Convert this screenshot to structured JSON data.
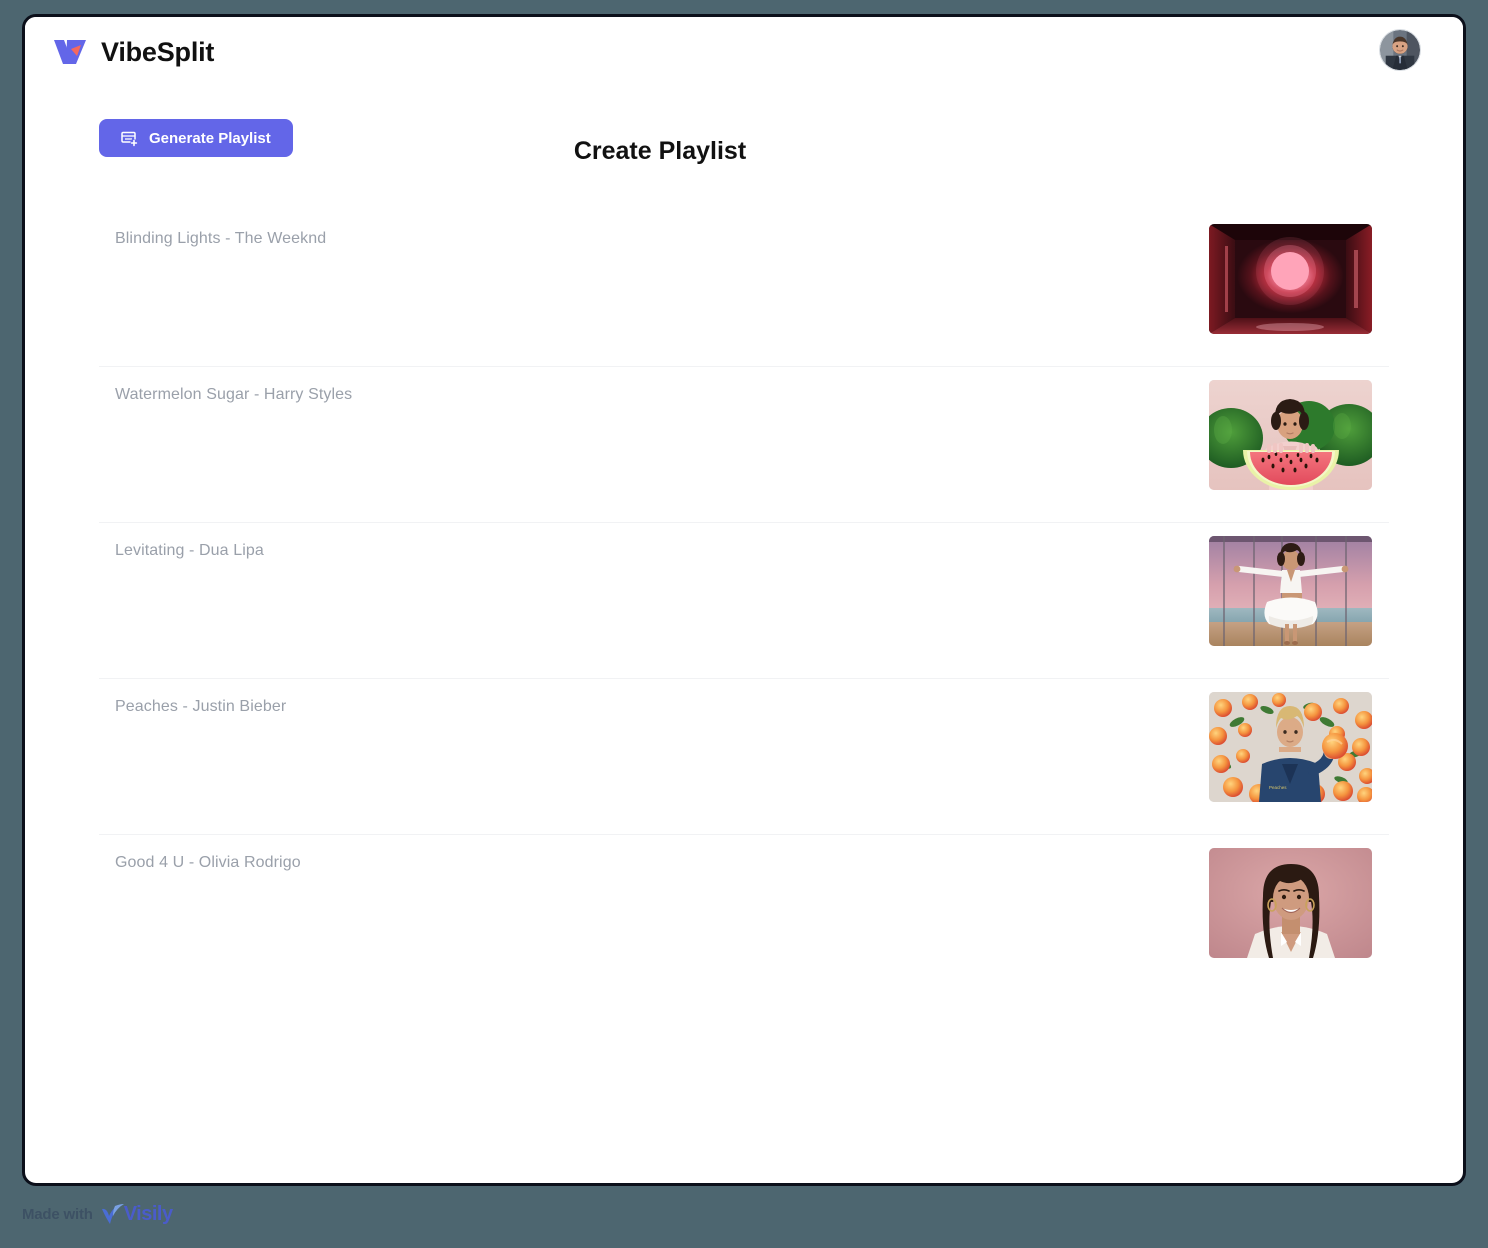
{
  "window": {
    "background_color": "#4d6670",
    "card_color": "#ffffff",
    "border_color": "#0b0f1a"
  },
  "header": {
    "brand_name": "VibeSplit",
    "brand_logo_icon": "vibesplit-logo-icon",
    "brand_logo_color": "#6366e8",
    "brand_logo_accent_color": "#f4685e",
    "avatar_icon": "user-avatar-photo"
  },
  "toolbar": {
    "generate_label": "Generate Playlist",
    "generate_icon": "playlist-add-icon",
    "accent_color": "#6366e8"
  },
  "main": {
    "title": "Create Playlist",
    "tracks": [
      {
        "title": "Blinding Lights - The Weeknd",
        "thumb_name": "thumbnail-blinding-lights",
        "thumb_alt": "dark red room with glowing pink light"
      },
      {
        "title": "Watermelon Sugar - Harry Styles",
        "thumb_name": "thumbnail-watermelon-sugar",
        "thumb_alt": "person in pink shirt holding watermelon slice"
      },
      {
        "title": "Levitating - Dua Lipa",
        "thumb_name": "thumbnail-levitating",
        "thumb_alt": "person in white outfit on beach at sunset"
      },
      {
        "title": "Peaches - Justin Bieber",
        "thumb_name": "thumbnail-peaches",
        "thumb_alt": "person in blue jacket holding a peach"
      },
      {
        "title": "Good 4 U - Olivia Rodrigo",
        "thumb_name": "thumbnail-good-4-u",
        "thumb_alt": "smiling person on pink background"
      }
    ]
  },
  "watermark": {
    "prefix": "Made with",
    "brand": "Visily"
  }
}
